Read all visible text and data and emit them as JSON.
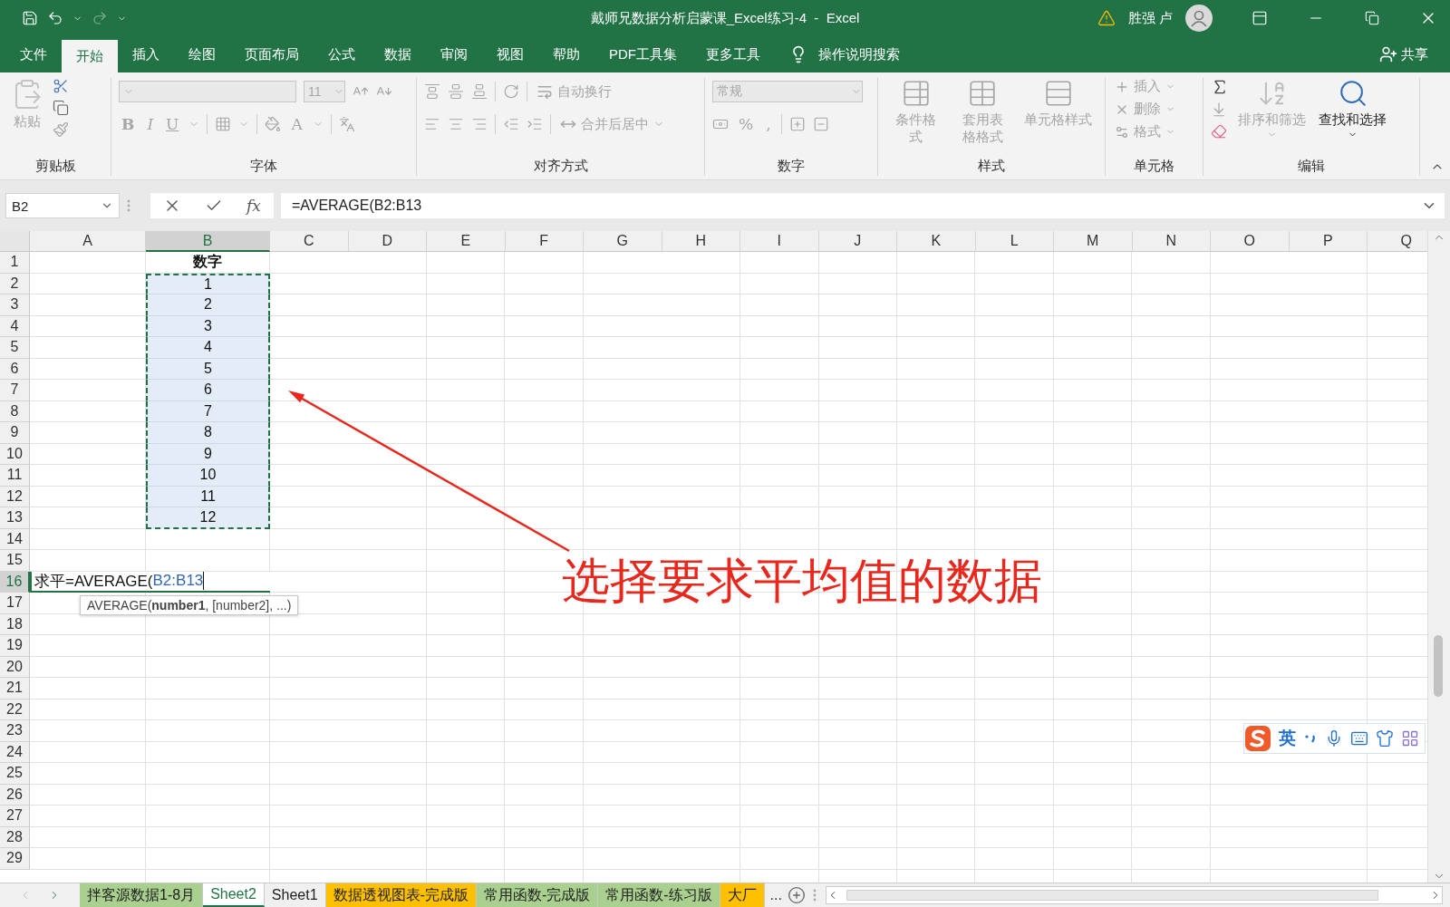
{
  "window": {
    "title": "戴师兄数据分析启蒙课_Excel练习-4  -  Excel",
    "user": "胜强 卢"
  },
  "ribbon_tabs": [
    {
      "label": "文件",
      "selected": false
    },
    {
      "label": "开始",
      "selected": true
    },
    {
      "label": "插入",
      "selected": false
    },
    {
      "label": "绘图",
      "selected": false
    },
    {
      "label": "页面布局",
      "selected": false
    },
    {
      "label": "公式",
      "selected": false
    },
    {
      "label": "数据",
      "selected": false
    },
    {
      "label": "审阅",
      "selected": false
    },
    {
      "label": "视图",
      "selected": false
    },
    {
      "label": "帮助",
      "selected": false
    },
    {
      "label": "PDF工具集",
      "selected": false
    },
    {
      "label": "更多工具",
      "selected": false
    }
  ],
  "tell_me": "操作说明搜索",
  "share": "共享",
  "ribbon": {
    "clipboard": {
      "label": "剪贴板",
      "paste": {
        "label": "粘贴",
        "disabled": true
      }
    },
    "font": {
      "label": "字体",
      "size": "11",
      "styles": [
        "B",
        "I",
        "U"
      ],
      "font_color": "A"
    },
    "alignment": {
      "label": "对齐方式",
      "wrap": {
        "label": "自动换行",
        "disabled": true
      },
      "merge": {
        "label": "合并后居中",
        "disabled": true
      }
    },
    "number": {
      "label": "数字",
      "format": "常规",
      "symbols": [
        "%",
        ","
      ]
    },
    "styles": {
      "label": "样式",
      "items": [
        {
          "label": "条件格式",
          "disabled": true
        },
        {
          "label": "套用表格格式",
          "disabled": true
        },
        {
          "label": "单元格样式",
          "disabled": true
        }
      ]
    },
    "cells": {
      "label": "单元格",
      "items": [
        {
          "label": "插入",
          "disabled": true
        },
        {
          "label": "删除",
          "disabled": true
        },
        {
          "label": "格式",
          "disabled": true
        }
      ]
    },
    "editing": {
      "label": "编辑",
      "items": [
        {
          "label": "排序和筛选",
          "disabled": true
        },
        {
          "label": "查找和选择",
          "disabled": false
        }
      ]
    }
  },
  "formula_bar": {
    "name_box": "B2",
    "function_button": "fx",
    "formula": "=AVERAGE(B2:B13"
  },
  "columns": [
    {
      "label": "A",
      "selected": false
    },
    {
      "label": "B",
      "selected": true
    },
    {
      "label": "C",
      "selected": false
    },
    {
      "label": "D",
      "selected": false
    },
    {
      "label": "E",
      "selected": false
    },
    {
      "label": "F",
      "selected": false
    },
    {
      "label": "G",
      "selected": false
    },
    {
      "label": "H",
      "selected": false
    },
    {
      "label": "I",
      "selected": false
    },
    {
      "label": "J",
      "selected": false
    },
    {
      "label": "K",
      "selected": false
    },
    {
      "label": "L",
      "selected": false
    },
    {
      "label": "M",
      "selected": false
    },
    {
      "label": "N",
      "selected": false
    },
    {
      "label": "O",
      "selected": false
    },
    {
      "label": "P",
      "selected": false
    },
    {
      "label": "Q",
      "selected": false
    }
  ],
  "rows": [
    {
      "label": "1",
      "selected": false,
      "B": {
        "text": "数字",
        "kind": "header",
        "in_range": false
      }
    },
    {
      "label": "2",
      "selected": false,
      "B": {
        "text": "1",
        "kind": "number",
        "in_range": true
      }
    },
    {
      "label": "3",
      "selected": false,
      "B": {
        "text": "2",
        "kind": "number",
        "in_range": true
      }
    },
    {
      "label": "4",
      "selected": false,
      "B": {
        "text": "3",
        "kind": "number",
        "in_range": true
      }
    },
    {
      "label": "5",
      "selected": false,
      "B": {
        "text": "4",
        "kind": "number",
        "in_range": true
      }
    },
    {
      "label": "6",
      "selected": false,
      "B": {
        "text": "5",
        "kind": "number",
        "in_range": true
      }
    },
    {
      "label": "7",
      "selected": false,
      "B": {
        "text": "6",
        "kind": "number",
        "in_range": true
      }
    },
    {
      "label": "8",
      "selected": false,
      "B": {
        "text": "7",
        "kind": "number",
        "in_range": true
      }
    },
    {
      "label": "9",
      "selected": false,
      "B": {
        "text": "8",
        "kind": "number",
        "in_range": true
      }
    },
    {
      "label": "10",
      "selected": false,
      "B": {
        "text": "9",
        "kind": "number",
        "in_range": true
      }
    },
    {
      "label": "11",
      "selected": false,
      "B": {
        "text": "10",
        "kind": "number",
        "in_range": true
      }
    },
    {
      "label": "12",
      "selected": false,
      "B": {
        "text": "11",
        "kind": "number",
        "in_range": true
      }
    },
    {
      "label": "13",
      "selected": false,
      "B": {
        "text": "12",
        "kind": "number",
        "in_range": true
      }
    },
    {
      "label": "14",
      "selected": false
    },
    {
      "label": "15",
      "selected": false
    },
    {
      "label": "16",
      "selected": true,
      "editing": {
        "text": "求平=AVERAGE(",
        "reference": "B2:B13"
      }
    },
    {
      "label": "17",
      "selected": false
    },
    {
      "label": "18",
      "selected": false
    },
    {
      "label": "19",
      "selected": false
    },
    {
      "label": "20",
      "selected": false
    },
    {
      "label": "21",
      "selected": false
    },
    {
      "label": "22",
      "selected": false
    },
    {
      "label": "23",
      "selected": false
    },
    {
      "label": "24",
      "selected": false
    },
    {
      "label": "25",
      "selected": false
    },
    {
      "label": "26",
      "selected": false
    },
    {
      "label": "27",
      "selected": false
    },
    {
      "label": "28",
      "selected": false
    },
    {
      "label": "29",
      "selected": false
    }
  ],
  "tooltip": "AVERAGE(**number1**, [number2], ...)",
  "sheet_tabs": [
    {
      "label": "拌客源数据1-8月",
      "selected": false,
      "color": "#a9d08e"
    },
    {
      "label": "Sheet2",
      "selected": true
    },
    {
      "label": "Sheet1",
      "selected": false
    },
    {
      "label": "数据透视图表-完成版",
      "selected": false,
      "color": "#ffc000"
    },
    {
      "label": "常用函数-完成版",
      "selected": false,
      "color": "#a9d08e"
    },
    {
      "label": "常用函数-练习版",
      "selected": false,
      "color": "#a9d08e"
    },
    {
      "label": "大厂",
      "selected": false,
      "color": "#ffc000"
    }
  ],
  "more_sheets": "...",
  "ime": {
    "mode": "英"
  },
  "annotation": {
    "text": "选择要求平均值的数据"
  }
}
